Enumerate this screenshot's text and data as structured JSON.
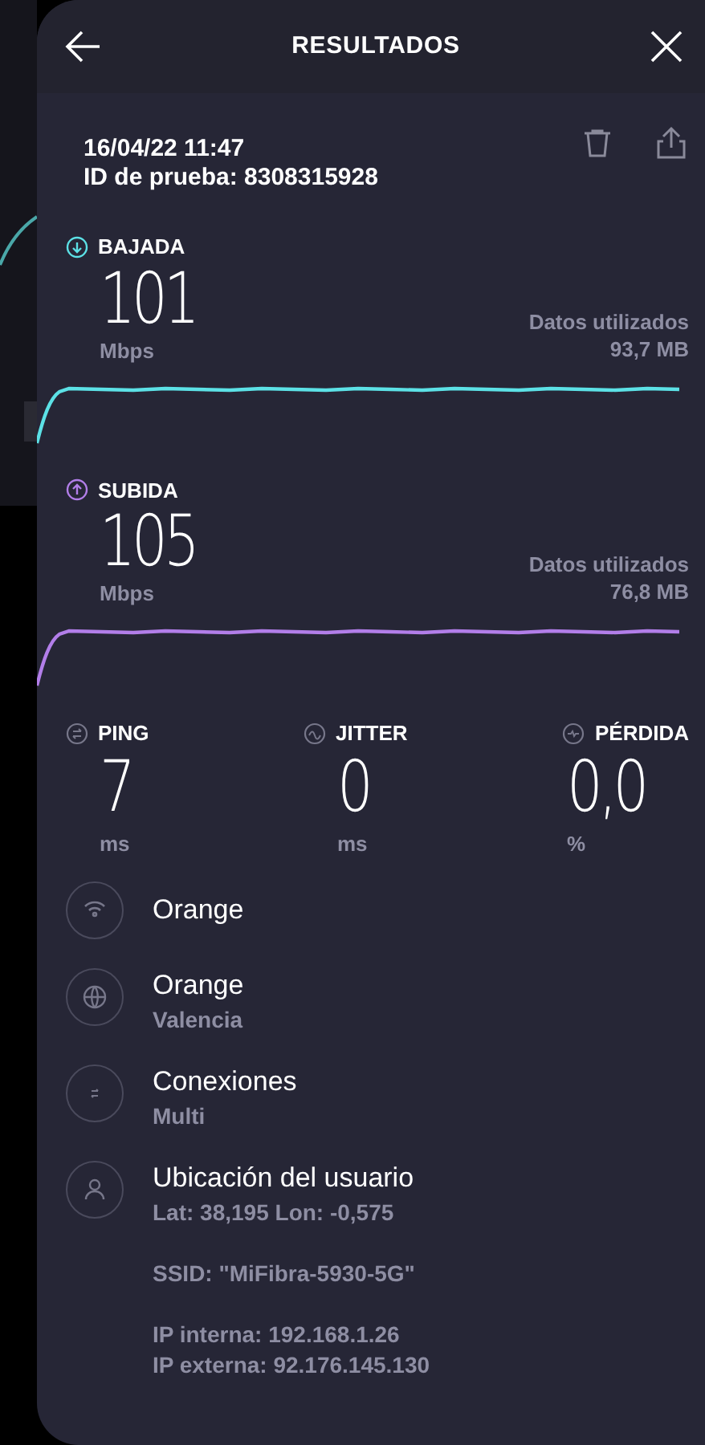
{
  "header": {
    "title": "RESULTADOS"
  },
  "test": {
    "date": "16/04/22 11:47",
    "id": "ID de prueba: 8308315928"
  },
  "speeds": [
    {
      "kind": "download",
      "label": "BAJADA",
      "value": "101",
      "unit": "Mbps",
      "data_label": "Datos utilizados",
      "data_value": "93,7 MB",
      "color": "#5ce1e6"
    },
    {
      "kind": "upload",
      "label": "SUBIDA",
      "value": "105",
      "unit": "Mbps",
      "data_label": "Datos utilizados",
      "data_value": "76,8 MB",
      "color": "#b27ee9"
    }
  ],
  "metrics": [
    {
      "kind": "ping",
      "label": "PING",
      "value": "7",
      "unit": "ms"
    },
    {
      "kind": "jitter",
      "label": "JITTER",
      "value": "0",
      "unit": "ms"
    },
    {
      "kind": "loss",
      "label": "PÉRDIDA",
      "value": "0,0",
      "unit": "%"
    }
  ],
  "info": [
    {
      "kind": "wifi",
      "title": "Orange"
    },
    {
      "kind": "globe",
      "title": "Orange",
      "subtitle": "Valencia"
    },
    {
      "kind": "connections",
      "title": "Conexiones",
      "subtitle": "Multi"
    },
    {
      "kind": "user",
      "title": "Ubicación del usuario",
      "subtitle": "Lat: 38,195 Lon: -0,575",
      "lines": [
        "SSID: \"MiFibra-5930-5G\"",
        [
          "IP interna: 192.168.1.26",
          "IP externa: 92.176.145.130"
        ]
      ]
    }
  ]
}
